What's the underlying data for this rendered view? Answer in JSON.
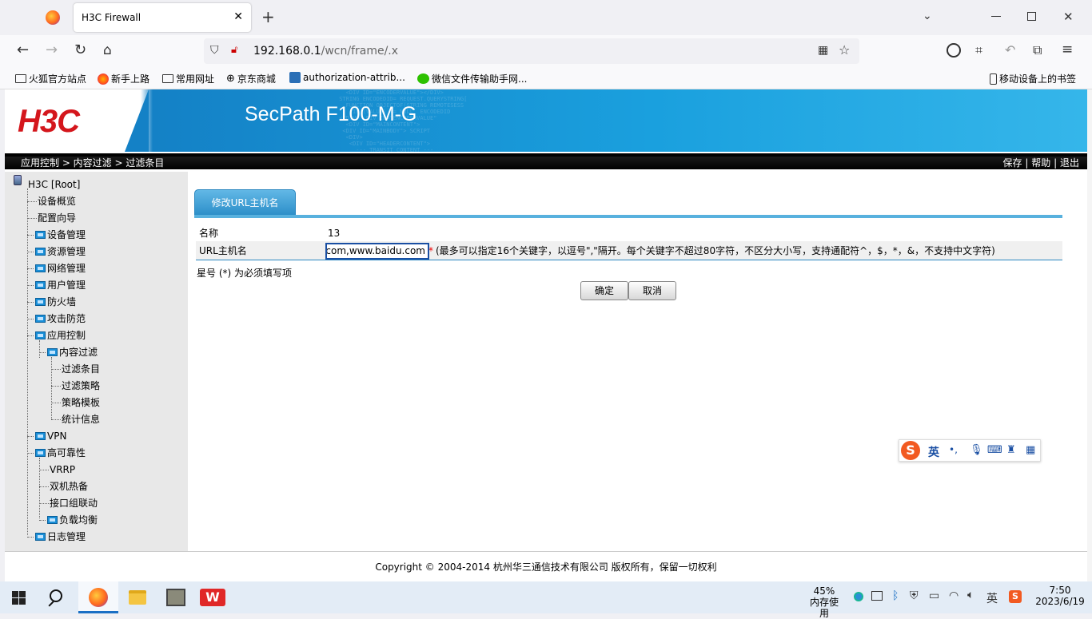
{
  "browser": {
    "tab_title": "H3C Firewall",
    "new_tab_label": "+",
    "url_host": "192.168.0.1",
    "url_path": "/wcn/frame/.x",
    "bookmarks": [
      {
        "label": "火狐官方站点",
        "icon": "folder-icon"
      },
      {
        "label": "新手上路",
        "icon": "firefox-icon"
      },
      {
        "label": "常用网址",
        "icon": "folder-icon"
      },
      {
        "label": "京东商城",
        "icon": "globe-icon"
      },
      {
        "label": "authorization-attrib...",
        "icon": "doc-icon"
      },
      {
        "label": "微信文件传输助手网...",
        "icon": "wechat-icon"
      }
    ],
    "mobile_bookmarks": "移动设备上的书签"
  },
  "header": {
    "logo": "H3C",
    "product": "SecPath F100-M-G",
    "breadcrumb": "应用控制 > 内容过滤 > 过滤条目",
    "links": {
      "save": "保存",
      "help": "帮助",
      "logout": "退出",
      "sep": "|"
    }
  },
  "sidebar": {
    "root": "H3C [Root]",
    "items": [
      {
        "label": "设备概览",
        "folder": false,
        "level": 1
      },
      {
        "label": "配置向导",
        "folder": false,
        "level": 1
      },
      {
        "label": "设备管理",
        "folder": true,
        "level": 1
      },
      {
        "label": "资源管理",
        "folder": true,
        "level": 1
      },
      {
        "label": "网络管理",
        "folder": true,
        "level": 1
      },
      {
        "label": "用户管理",
        "folder": true,
        "level": 1
      },
      {
        "label": "防火墙",
        "folder": true,
        "level": 1
      },
      {
        "label": "攻击防范",
        "folder": true,
        "level": 1
      },
      {
        "label": "应用控制",
        "folder": true,
        "level": 1
      },
      {
        "label": "内容过滤",
        "folder": true,
        "level": 2
      },
      {
        "label": "过滤条目",
        "folder": false,
        "level": 3
      },
      {
        "label": "过滤策略",
        "folder": false,
        "level": 3
      },
      {
        "label": "策略模板",
        "folder": false,
        "level": 3
      },
      {
        "label": "统计信息",
        "folder": false,
        "level": 3
      },
      {
        "label": "VPN",
        "folder": true,
        "level": 1
      },
      {
        "label": "高可靠性",
        "folder": true,
        "level": 1
      },
      {
        "label": "VRRP",
        "folder": false,
        "level": 2
      },
      {
        "label": "双机热备",
        "folder": false,
        "level": 2
      },
      {
        "label": "接口组联动",
        "folder": false,
        "level": 2
      },
      {
        "label": "负载均衡",
        "folder": true,
        "level": 2
      },
      {
        "label": "日志管理",
        "folder": true,
        "level": 1
      }
    ]
  },
  "form": {
    "tab_title": "修改URL主机名",
    "name_label": "名称",
    "name_value": "13",
    "url_label": "URL主机名",
    "url_value": "www.baidu.com,www.baidu.com",
    "required_mark": "*",
    "url_hint": "(最多可以指定16个关键字，以逗号\",\"隔开。每个关键字不超过80字符，不区分大小写，支持通配符^，$，*，&，不支持中文字符)",
    "required_note": "星号 (*) 为必须填写项",
    "ok_label": "确定",
    "cancel_label": "取消"
  },
  "footer": {
    "copyright": "Copyright © 2004-2014 杭州华三通信技术有限公司 版权所有，保留一切权利"
  },
  "ime": {
    "lang": "英",
    "punct": "•,"
  },
  "taskbar": {
    "mem_percent": "45%",
    "mem_label": "内存使用",
    "ime_lang": "英",
    "time": "7:50",
    "date": "2023/6/19"
  }
}
